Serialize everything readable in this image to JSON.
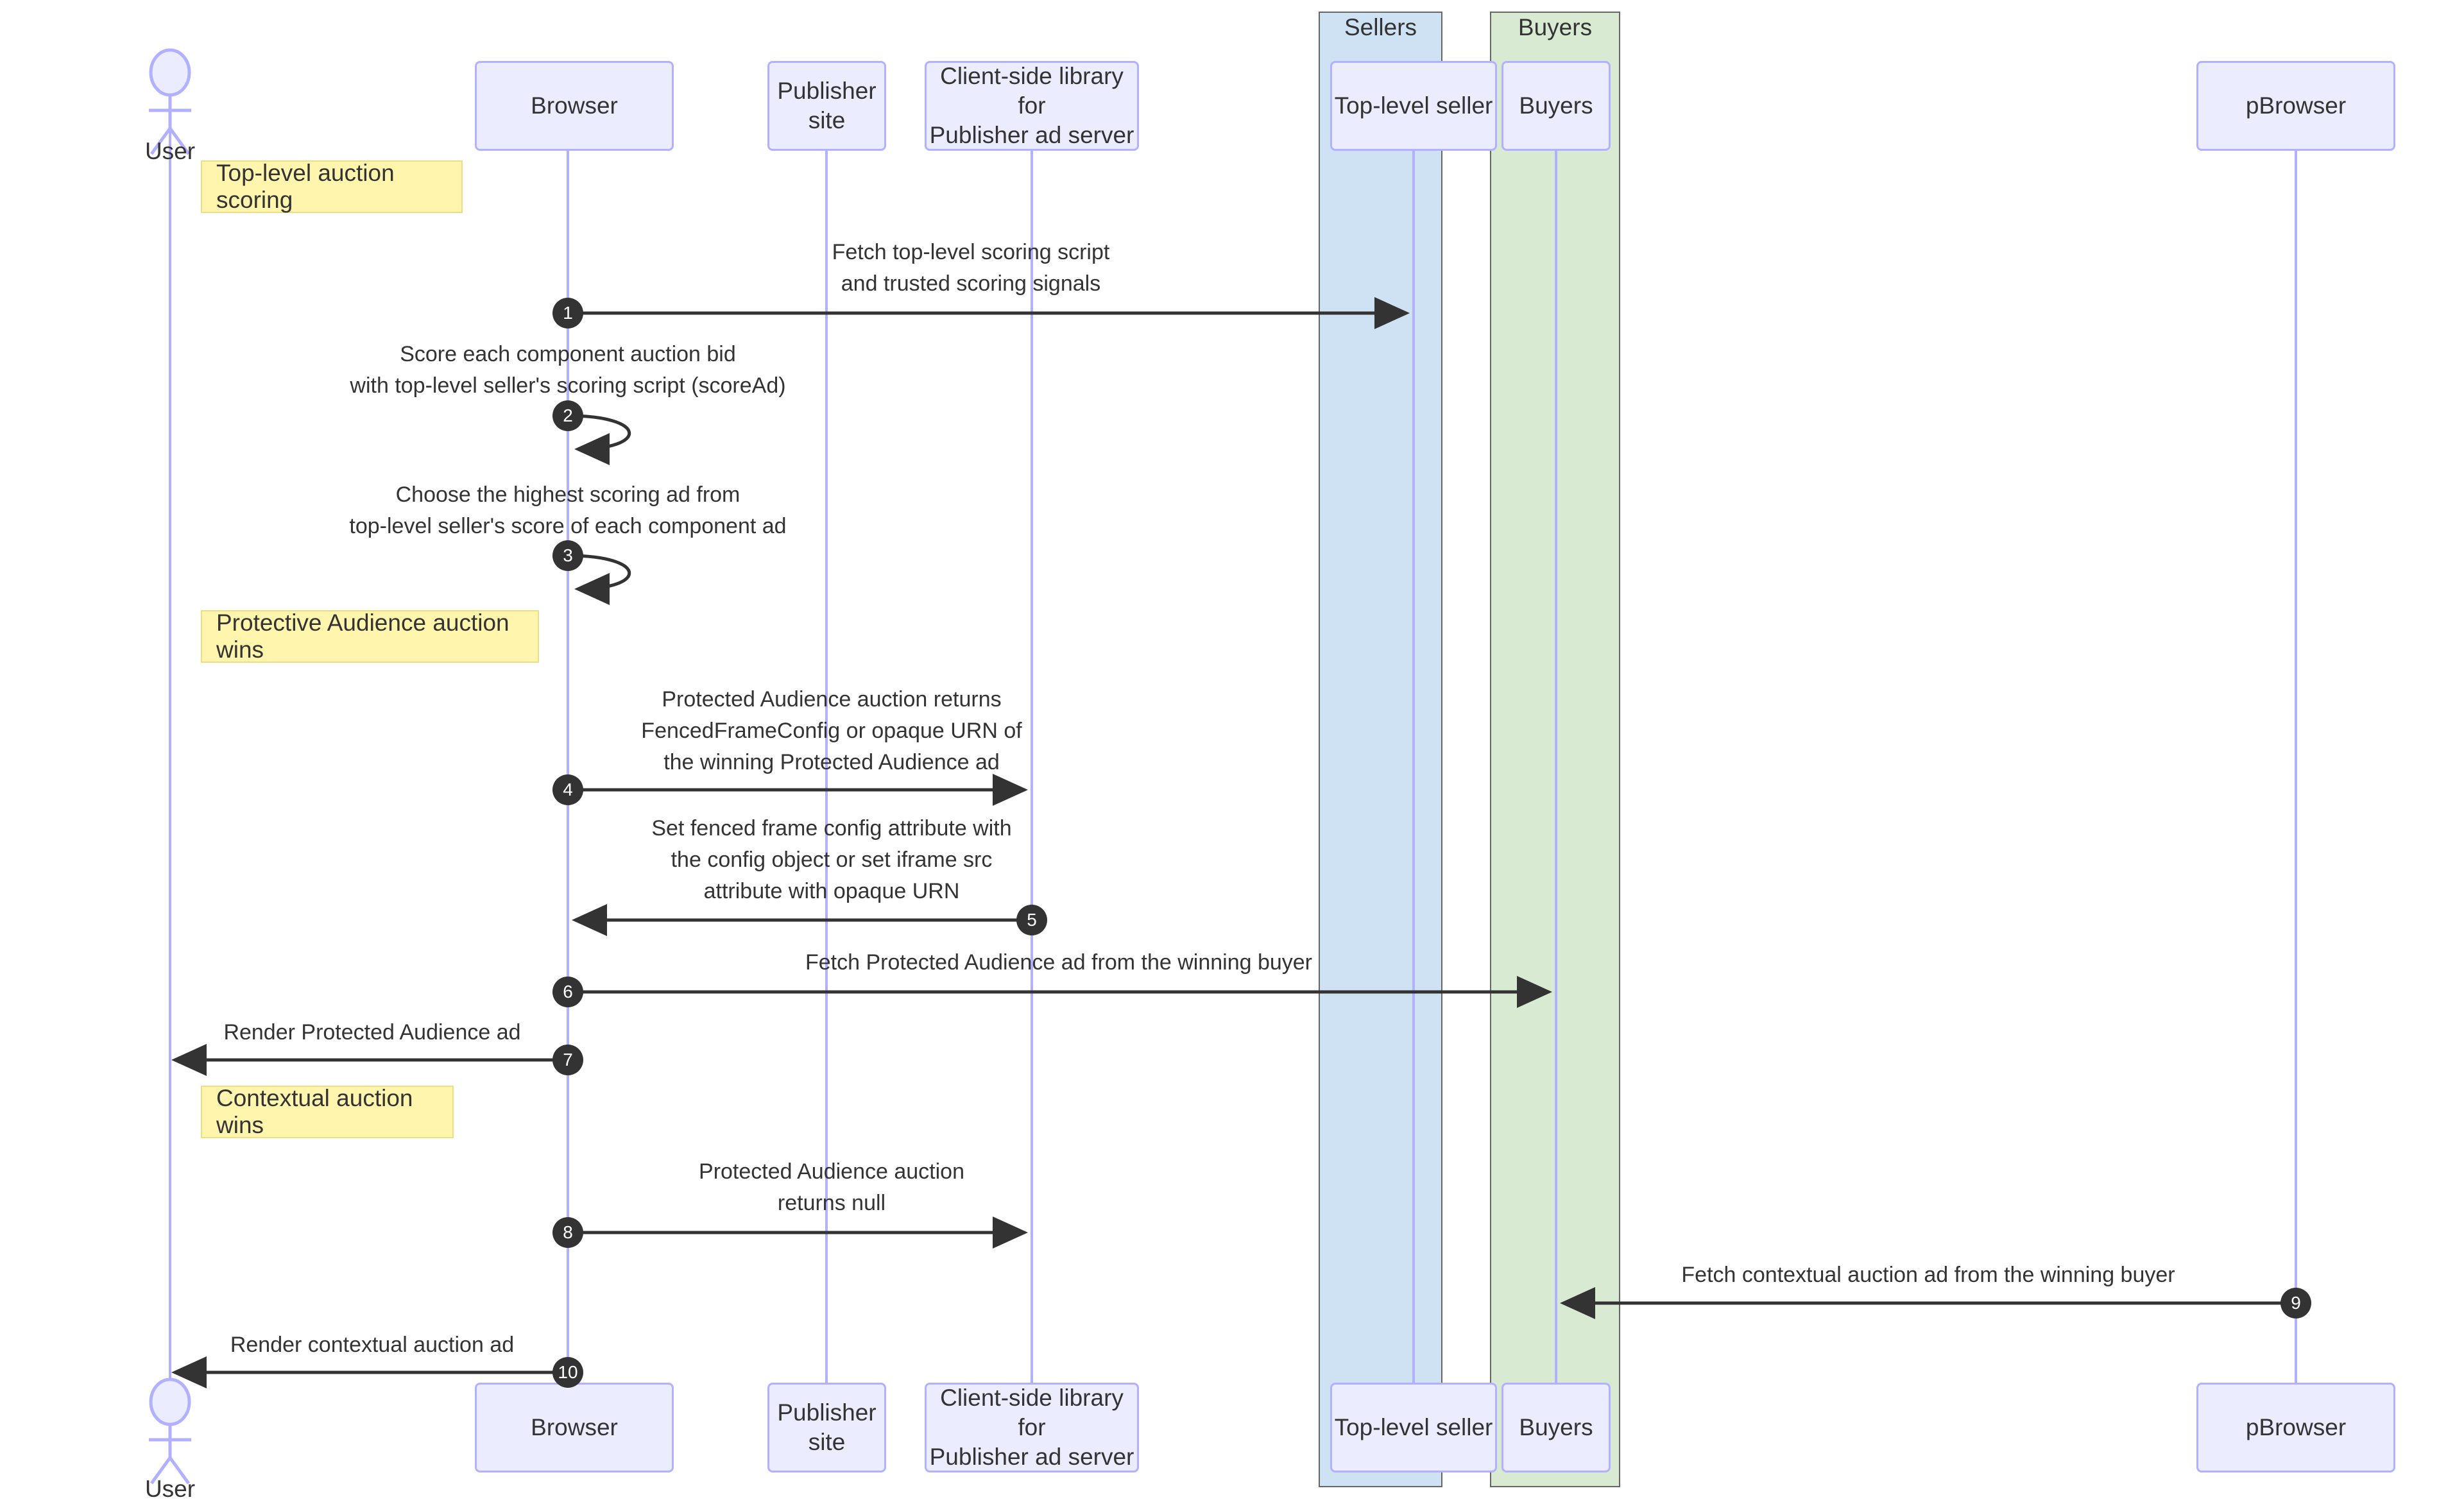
{
  "diagram": {
    "type": "sequence-diagram",
    "title": "Protected Audience top-level auction sequence",
    "colors": {
      "participant_fill": "#ECECFF",
      "participant_stroke": "#9370DB",
      "note_fill": "#FFF5AD",
      "note_stroke": "#EEDD82",
      "sellers_group_fill": "#CFE2F3",
      "buyers_group_fill": "#D9EAD3",
      "group_stroke": "#666666",
      "lifeline_stroke": "#B1B1FF",
      "arrow_stroke": "#333333",
      "seqnum_fill": "#333333",
      "text": "#333333"
    }
  },
  "groups": [
    {
      "id": "sellers",
      "label": "Sellers"
    },
    {
      "id": "buyers",
      "label": "Buyers"
    }
  ],
  "actors": [
    {
      "id": "user",
      "label": "User",
      "kind": "actor"
    }
  ],
  "participants": [
    {
      "id": "browser",
      "label": "Browser",
      "kind": "box"
    },
    {
      "id": "publisher",
      "label": "Publisher site",
      "kind": "box"
    },
    {
      "id": "clientlib",
      "label": "Client-side library for\nPublisher ad server",
      "line1": "Client-side library for",
      "line2": "Publisher ad server",
      "kind": "box"
    },
    {
      "id": "topseller",
      "label": "Top-level seller",
      "kind": "box",
      "group": "sellers"
    },
    {
      "id": "buyers",
      "label": "Buyers",
      "kind": "box",
      "group": "buyers"
    },
    {
      "id": "pbrowser",
      "label": "pBrowser",
      "kind": "box"
    }
  ],
  "notes": [
    {
      "id": "note-1",
      "text": "Top-level auction scoring"
    },
    {
      "id": "note-2",
      "text": "Protective Audience auction wins"
    },
    {
      "id": "note-3",
      "text": "Contextual auction wins"
    }
  ],
  "messages": [
    {
      "num": "1",
      "from": "browser",
      "to": "topseller",
      "direction": "right",
      "self": false,
      "lines": [
        "Fetch top-level scoring script",
        "and trusted scoring signals"
      ]
    },
    {
      "num": "2",
      "from": "browser",
      "to": "browser",
      "direction": "self",
      "self": true,
      "lines": [
        "Score each component auction bid",
        "with top-level seller's scoring script (scoreAd)"
      ]
    },
    {
      "num": "3",
      "from": "browser",
      "to": "browser",
      "direction": "self",
      "self": true,
      "lines": [
        "Choose the highest scoring ad from",
        "top-level seller's score of each component ad"
      ]
    },
    {
      "num": "4",
      "from": "browser",
      "to": "clientlib",
      "direction": "right",
      "self": false,
      "lines": [
        "Protected Audience auction returns",
        "FencedFrameConfig or opaque URN of",
        "the winning Protected Audience ad"
      ]
    },
    {
      "num": "5",
      "from": "clientlib",
      "to": "browser",
      "direction": "left",
      "self": false,
      "lines": [
        "Set fenced frame config attribute with",
        "the config object or set iframe src",
        "attribute with opaque URN"
      ]
    },
    {
      "num": "6",
      "from": "browser",
      "to": "buyers",
      "direction": "right",
      "self": false,
      "lines": [
        "Fetch Protected Audience ad from the winning buyer"
      ]
    },
    {
      "num": "7",
      "from": "browser",
      "to": "user",
      "direction": "left",
      "self": false,
      "lines": [
        "Render Protected Audience ad"
      ]
    },
    {
      "num": "8",
      "from": "browser",
      "to": "clientlib",
      "direction": "right",
      "self": false,
      "lines": [
        "Protected Audience auction",
        "returns null"
      ]
    },
    {
      "num": "9",
      "from": "pbrowser",
      "to": "buyers",
      "direction": "left",
      "self": false,
      "lines": [
        "Fetch contextual auction ad from the winning buyer"
      ]
    },
    {
      "num": "10",
      "from": "browser",
      "to": "user",
      "direction": "left",
      "self": false,
      "lines": [
        "Render contextual auction ad"
      ]
    }
  ]
}
